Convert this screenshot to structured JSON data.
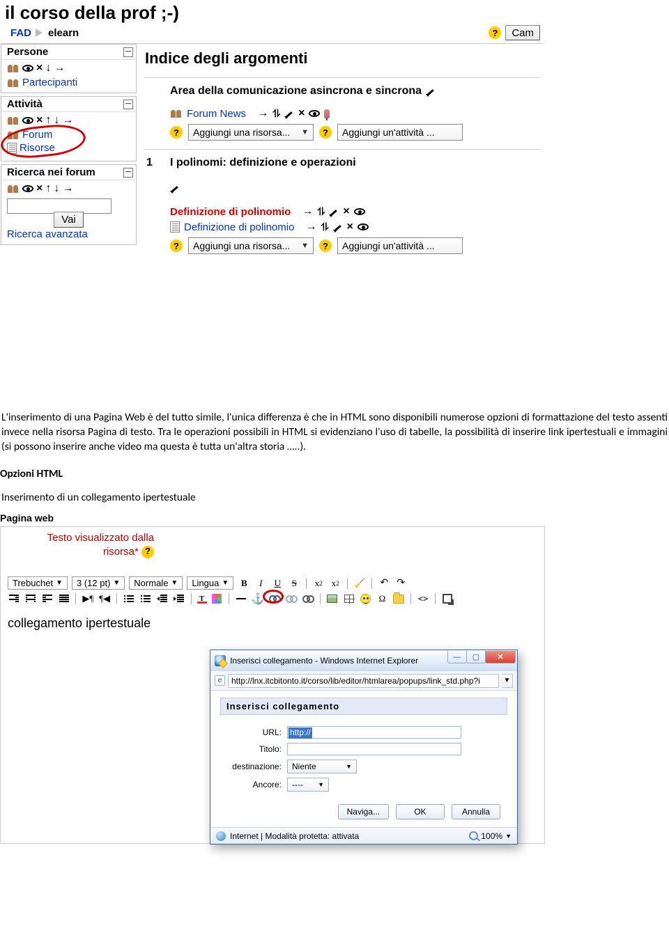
{
  "moodle": {
    "course_title": "il corso della prof ;-)",
    "breadcrumb": {
      "root": "FAD",
      "current": "elearn"
    },
    "edit_button_partial": "Cam",
    "persone": {
      "title": "Persone",
      "partecipanti": "Partecipanti"
    },
    "attivita": {
      "title": "Attività",
      "forum": "Forum",
      "risorse": "Risorse"
    },
    "ricerca": {
      "title": "Ricerca nei forum",
      "vai": "Vai",
      "avanzata": "Ricerca avanzata"
    },
    "main_heading": "Indice degli argomenti",
    "section0": {
      "title": "Area della comunicazione asincrona e sincrona",
      "forum_news": "Forum News",
      "add_resource": "Aggiungi una risorsa...",
      "add_activity": "Aggiungi un'attività ..."
    },
    "section1": {
      "num": "1",
      "title": "I polinomi: definizione e operazioni",
      "def_link_red": "Definizione di polinomio",
      "def_link_blue": "Definizione di polinomio",
      "add_resource": "Aggiungi una risorsa...",
      "add_activity": "Aggiungi un'attività ..."
    }
  },
  "doc": {
    "p1": "L'inserimento di una Pagina Web è del tutto simile, l'unica differenza è che in HTML sono disponibili numerose opzioni di formattazione del testo assenti invece nella risorsa Pagina di testo. Tra le operazioni possibili in HTML si evidenziano l'uso di tabelle, la possibilità di inserire link ipertestuali e immagini (si possono inserire anche video ma questa è tutta un'altra storia …..).",
    "h1": "Opzioni HTML",
    "p2": "Inserimento di un collegamento ipertestuale"
  },
  "shot2": {
    "fieldset": "Pagina web",
    "prompt_line1": "Testo visualizzato dalla",
    "prompt_line2": "risorsa*",
    "font": "Trebuchet",
    "size": "3 (12 pt)",
    "style": "Normale",
    "lang": "Lingua",
    "editor_text": "collegamento ipertestuale",
    "popup": {
      "title": "Inserisci collegamento - Windows Internet Explorer",
      "url_bar": "http://lnx.itcbitonto.it/corso/lib/editor/htmlarea/popups/link_std.php?i",
      "head": "Inserisci collegamento",
      "url_label": "URL:",
      "url_value": "http://",
      "title_label": "Titolo:",
      "dest_label": "destinazione:",
      "dest_value": "Niente",
      "anchor_label": "Ancore:",
      "anchor_value": "----",
      "browse": "Naviga...",
      "ok": "OK",
      "cancel": "Annulla",
      "status": "Internet | Modalità protetta: attivata",
      "zoom": "100%"
    }
  }
}
